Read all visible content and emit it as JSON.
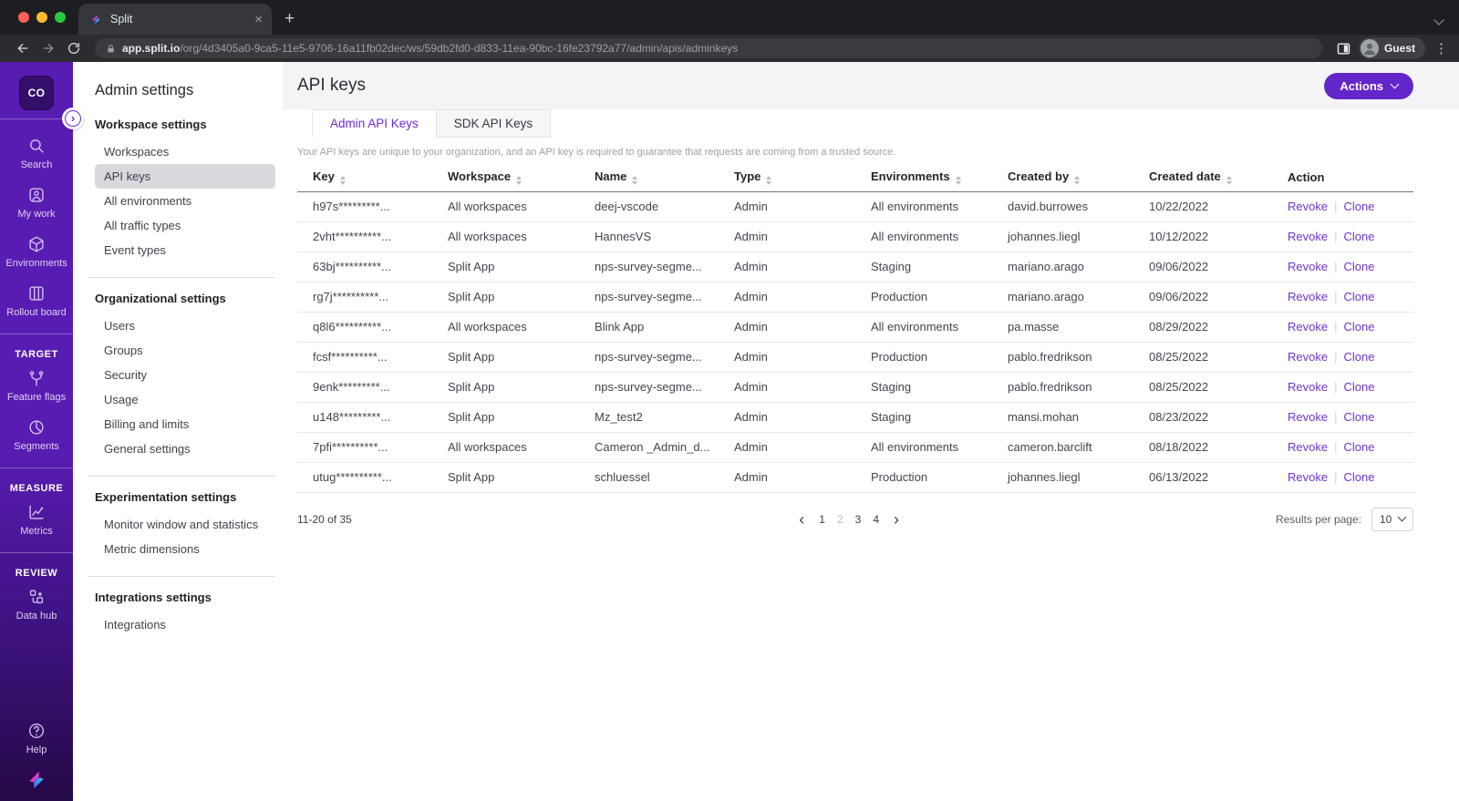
{
  "colors": {
    "accent": "#6b2bd9",
    "primary_button": "#6226c9",
    "link": "#6d33d6",
    "sidebar_top": "#591cb3",
    "sidebar_bottom": "#260947"
  },
  "browser": {
    "tab": {
      "title": "Split"
    },
    "url": {
      "host": "app.split.io",
      "path": "/org/4d3405a0-9ca5-11e5-9706-16a11fb02dec/ws/59db2fd0-d833-11ea-90bc-16fe23792a77/admin/apis/adminkeys"
    },
    "profile": "Guest"
  },
  "sidebar": {
    "workspace_badge": "CO",
    "groups": [
      {
        "header": null,
        "items": [
          {
            "icon": "search-icon",
            "label": "Search"
          },
          {
            "icon": "my-work-icon",
            "label": "My work"
          },
          {
            "icon": "environments-icon",
            "label": "Environments"
          },
          {
            "icon": "rollout-board-icon",
            "label": "Rollout board"
          }
        ]
      },
      {
        "header": "TARGET",
        "items": [
          {
            "icon": "feature-flags-icon",
            "label": "Feature flags"
          },
          {
            "icon": "segments-icon",
            "label": "Segments"
          }
        ]
      },
      {
        "header": "MEASURE",
        "items": [
          {
            "icon": "metrics-icon",
            "label": "Metrics"
          }
        ]
      },
      {
        "header": "REVIEW",
        "items": [
          {
            "icon": "data-hub-icon",
            "label": "Data hub"
          }
        ]
      }
    ],
    "bottom": {
      "icon": "help-icon",
      "label": "Help"
    }
  },
  "admin_nav": {
    "title": "Admin settings",
    "groups": [
      {
        "header": "Workspace settings",
        "items": [
          {
            "label": "Workspaces"
          },
          {
            "label": "API keys",
            "active": true
          },
          {
            "label": "All environments"
          },
          {
            "label": "All traffic types"
          },
          {
            "label": "Event types"
          }
        ]
      },
      {
        "header": "Organizational settings",
        "items": [
          {
            "label": "Users"
          },
          {
            "label": "Groups"
          },
          {
            "label": "Security"
          },
          {
            "label": "Usage"
          },
          {
            "label": "Billing and limits"
          },
          {
            "label": "General settings"
          }
        ]
      },
      {
        "header": "Experimentation settings",
        "items": [
          {
            "label": "Monitor window and statistics"
          },
          {
            "label": "Metric dimensions"
          }
        ]
      },
      {
        "header": "Integrations settings",
        "items": [
          {
            "label": "Integrations"
          }
        ]
      }
    ]
  },
  "page": {
    "title": "API keys",
    "actions_label": "Actions",
    "tabs": [
      {
        "label": "Admin API Keys",
        "active": true
      },
      {
        "label": "SDK API Keys",
        "active": false
      }
    ],
    "description": "Your API keys are unique to your organization, and an API key is required to guarantee that requests are coming from a trusted source."
  },
  "table": {
    "columns": [
      {
        "label": "Key",
        "sortable": true
      },
      {
        "label": "Workspace",
        "sortable": true
      },
      {
        "label": "Name",
        "sortable": true
      },
      {
        "label": "Type",
        "sortable": true
      },
      {
        "label": "Environments",
        "sortable": true
      },
      {
        "label": "Created by",
        "sortable": true
      },
      {
        "label": "Created date",
        "sortable": true
      },
      {
        "label": "Action",
        "sortable": false
      }
    ],
    "action_labels": {
      "revoke": "Revoke",
      "clone": "Clone"
    },
    "rows": [
      {
        "key": "h97s*********...",
        "workspace": "All workspaces",
        "name": "deej-vscode",
        "type": "Admin",
        "environments": "All environments",
        "created_by": "david.burrowes",
        "created_date": "10/22/2022"
      },
      {
        "key": "2vht**********...",
        "workspace": "All workspaces",
        "name": "HannesVS",
        "type": "Admin",
        "environments": "All environments",
        "created_by": "johannes.liegl",
        "created_date": "10/12/2022"
      },
      {
        "key": "63bj**********...",
        "workspace": "Split App",
        "name": "nps-survey-segme...",
        "type": "Admin",
        "environments": "Staging",
        "created_by": "mariano.arago",
        "created_date": "09/06/2022"
      },
      {
        "key": "rg7j**********...",
        "workspace": "Split App",
        "name": "nps-survey-segme...",
        "type": "Admin",
        "environments": "Production",
        "created_by": "mariano.arago",
        "created_date": "09/06/2022"
      },
      {
        "key": "q8l6**********...",
        "workspace": "All workspaces",
        "name": "Blink App",
        "type": "Admin",
        "environments": "All environments",
        "created_by": "pa.masse",
        "created_date": "08/29/2022"
      },
      {
        "key": "fcsf**********...",
        "workspace": "Split App",
        "name": "nps-survey-segme...",
        "type": "Admin",
        "environments": "Production",
        "created_by": "pablo.fredrikson",
        "created_date": "08/25/2022"
      },
      {
        "key": "9enk*********...",
        "workspace": "Split App",
        "name": "nps-survey-segme...",
        "type": "Admin",
        "environments": "Staging",
        "created_by": "pablo.fredrikson",
        "created_date": "08/25/2022"
      },
      {
        "key": "u148*********...",
        "workspace": "Split App",
        "name": "Mz_test2",
        "type": "Admin",
        "environments": "Staging",
        "created_by": "mansi.mohan",
        "created_date": "08/23/2022"
      },
      {
        "key": "7pfi**********...",
        "workspace": "All workspaces",
        "name": "Cameron _Admin_d...",
        "type": "Admin",
        "environments": "All environments",
        "created_by": "cameron.barclift",
        "created_date": "08/18/2022"
      },
      {
        "key": "utug**********...",
        "workspace": "Split App",
        "name": "schluessel",
        "type": "Admin",
        "environments": "Production",
        "created_by": "johannes.liegl",
        "created_date": "06/13/2022"
      }
    ]
  },
  "pagination": {
    "range": "11-20 of 35",
    "pages": [
      "1",
      "2",
      "3",
      "4"
    ],
    "current_page": "2",
    "results_per_page_label": "Results per page:",
    "results_per_page_value": "10"
  }
}
